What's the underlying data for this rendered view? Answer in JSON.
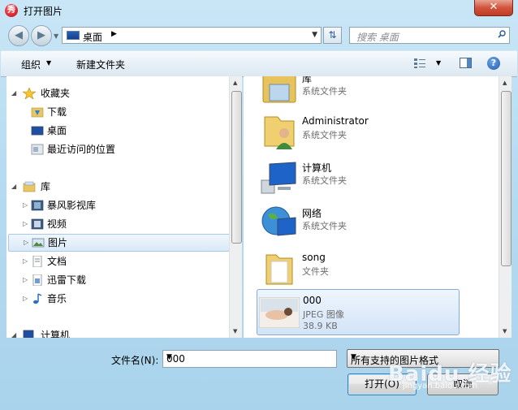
{
  "window": {
    "title": "打开图片",
    "close_label": "✕"
  },
  "nav": {
    "address": "桌面",
    "search_placeholder": "搜索 桌面"
  },
  "toolbar": {
    "organize": "组织",
    "new_folder": "新建文件夹"
  },
  "tree": {
    "favorites": {
      "label": "收藏夹",
      "items": [
        "下载",
        "桌面",
        "最近访问的位置"
      ]
    },
    "libraries": {
      "label": "库",
      "items": [
        "暴风影视库",
        "视频",
        "图片",
        "文档",
        "迅雷下载",
        "音乐"
      ],
      "selected": "图片"
    },
    "computer": {
      "label": "计算机"
    }
  },
  "files": [
    {
      "name": "库",
      "type": "系统文件夹",
      "icon": "library-icon"
    },
    {
      "name": "Administrator",
      "type": "系统文件夹",
      "icon": "user-folder-icon"
    },
    {
      "name": "计算机",
      "type": "系统文件夹",
      "icon": "computer-icon"
    },
    {
      "name": "网络",
      "type": "系统文件夹",
      "icon": "network-icon"
    },
    {
      "name": "song",
      "type": "文件夹",
      "icon": "folder-icon"
    },
    {
      "name": "000",
      "type": "JPEG 图像",
      "size": "38.9 KB",
      "icon": "image-thumbnail",
      "selected": true
    }
  ],
  "bottom": {
    "filename_label": "文件名(N):",
    "filename_value": "000",
    "filter_value": "所有支持的图片格式",
    "open_label": "打开(O)",
    "cancel_label": "取消"
  },
  "watermark": {
    "logo": "Baidu 经验",
    "url": "jingyan.baidu.com"
  },
  "colors": {
    "accent": "#3c7fb1",
    "selection": "#d2e4f8",
    "close": "#c23b23"
  }
}
